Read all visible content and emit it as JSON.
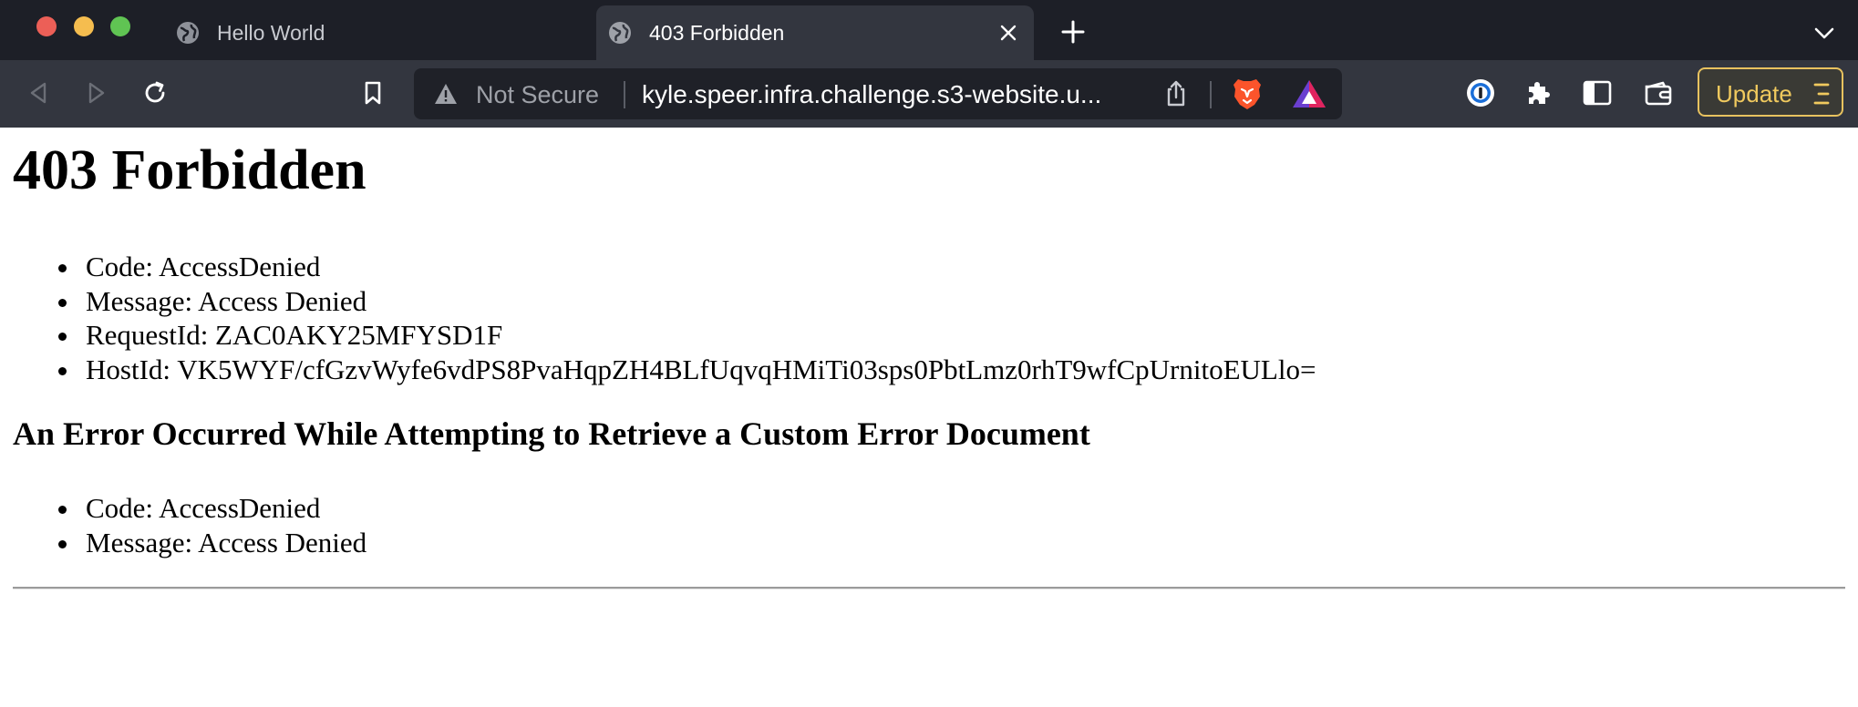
{
  "window": {
    "traffic_lights": [
      "#ec5f57",
      "#f5bd4f",
      "#60c453"
    ]
  },
  "tabs": [
    {
      "title": "Hello World",
      "icon": "globe-icon",
      "active": false
    },
    {
      "title": "403 Forbidden",
      "icon": "globe-icon",
      "active": true
    }
  ],
  "toolbar": {
    "security_label": "Not Secure",
    "url": "kyle.speer.infra.challenge.s3-website.u...",
    "update_label": "Update",
    "accent": "#f0c95e"
  },
  "page": {
    "title": "403 Forbidden",
    "items": [
      "Code: AccessDenied",
      "Message: Access Denied",
      "RequestId: ZAC0AKY25MFYSD1F",
      "HostId: VK5WYF/cfGzvWyfe6vdPS8PvaHqpZH4BLfUqvqHMiTi03sps0PbtLmz0rhT9wfCpUrnitoEULlo="
    ],
    "subheading": "An Error Occurred While Attempting to Retrieve a Custom Error Document",
    "sub_items": [
      "Code: AccessDenied",
      "Message: Access Denied"
    ]
  }
}
